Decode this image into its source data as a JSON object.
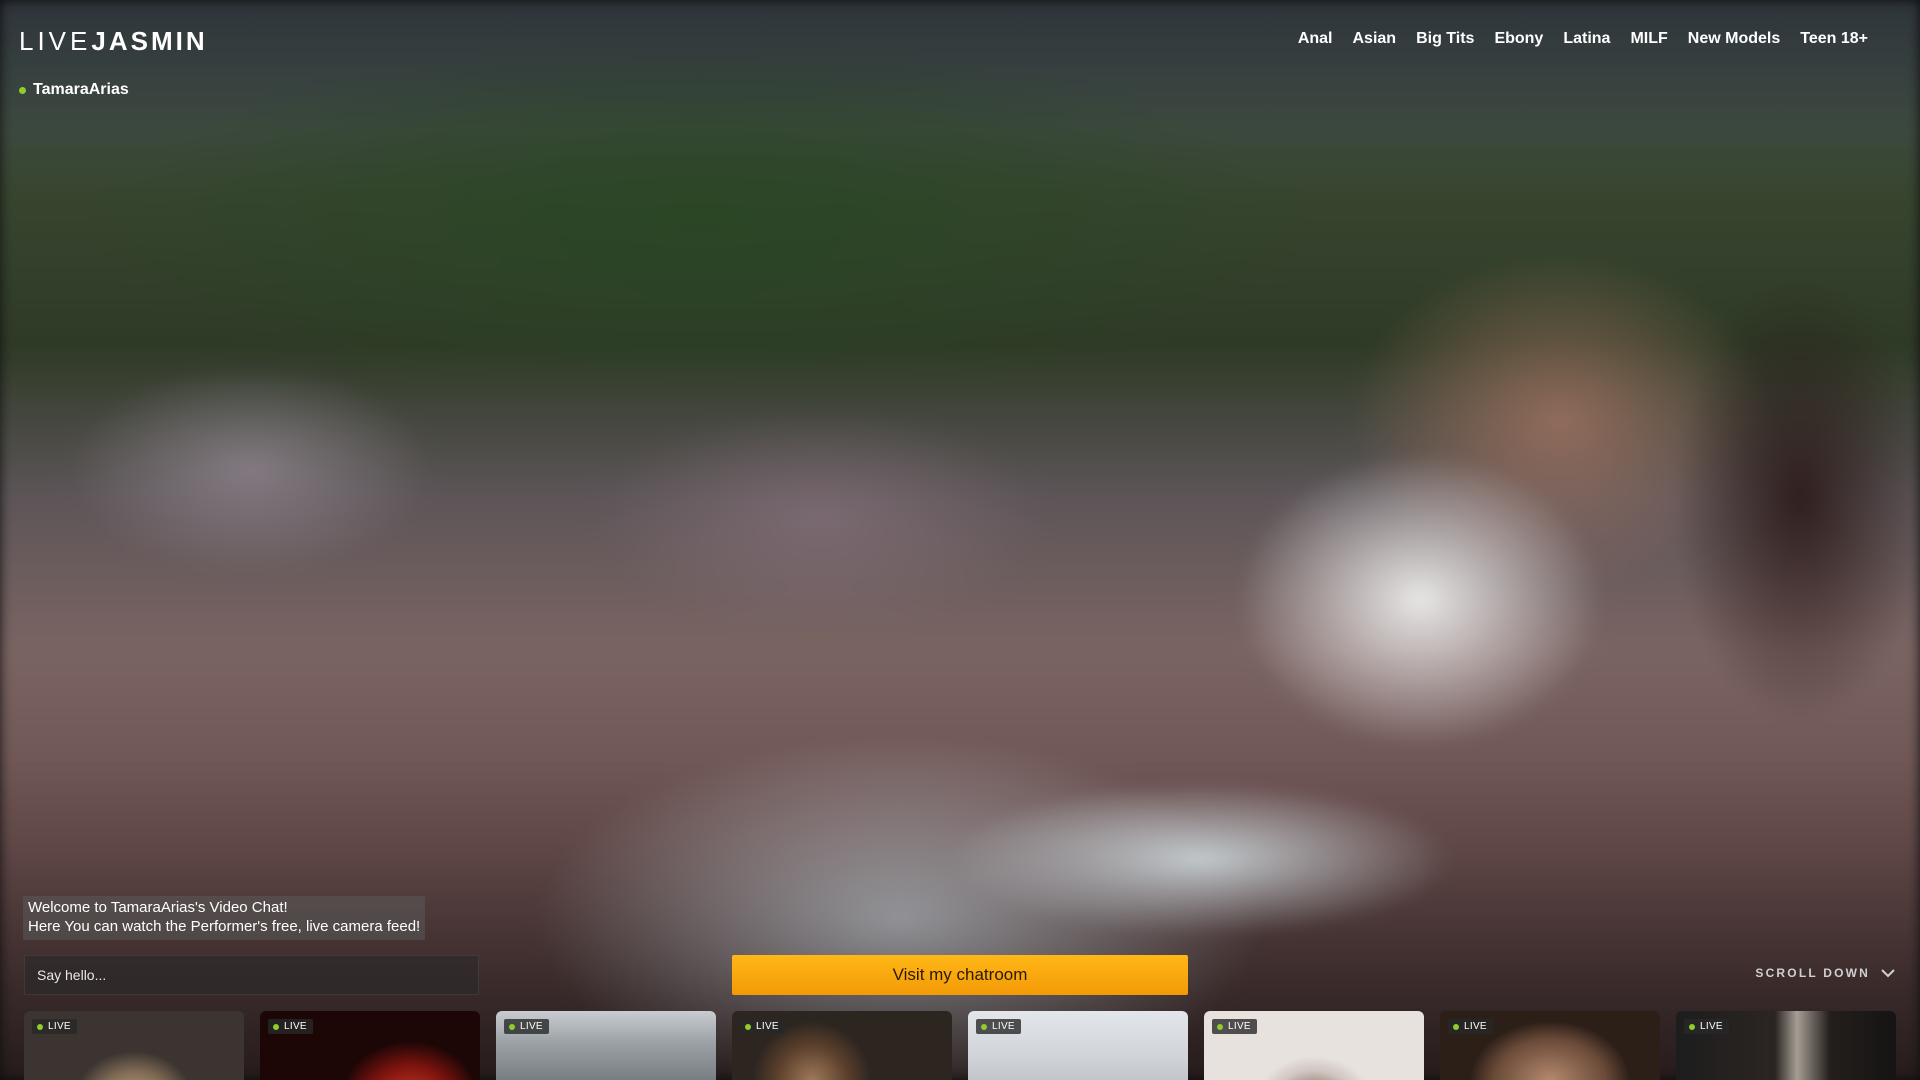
{
  "header": {
    "logo_light": "LIVE",
    "logo_bold": "JASMIN",
    "nav": [
      {
        "label": "Anal"
      },
      {
        "label": "Asian"
      },
      {
        "label": "Big Tits"
      },
      {
        "label": "Ebony"
      },
      {
        "label": "Latina"
      },
      {
        "label": "MILF"
      },
      {
        "label": "New Models"
      },
      {
        "label": "Teen 18+"
      }
    ]
  },
  "performer": {
    "name": "TamaraArias",
    "status_color": "#8fcc2c"
  },
  "welcome": {
    "line1": "Welcome to TamaraArias's Video Chat!",
    "line2": "Here You can watch the Performer's free, live camera feed!"
  },
  "chat": {
    "placeholder": "Say hello..."
  },
  "cta": {
    "label": "Visit my chatroom",
    "color": "#f7a90c"
  },
  "scroll": {
    "label": "SCROLL DOWN",
    "icon": "chevron-down-icon"
  },
  "thumbnails": [
    {
      "badge": "LIVE"
    },
    {
      "badge": "LIVE"
    },
    {
      "badge": "LIVE"
    },
    {
      "badge": "LIVE"
    },
    {
      "badge": "LIVE"
    },
    {
      "badge": "LIVE"
    },
    {
      "badge": "LIVE"
    },
    {
      "badge": "LIVE"
    }
  ]
}
